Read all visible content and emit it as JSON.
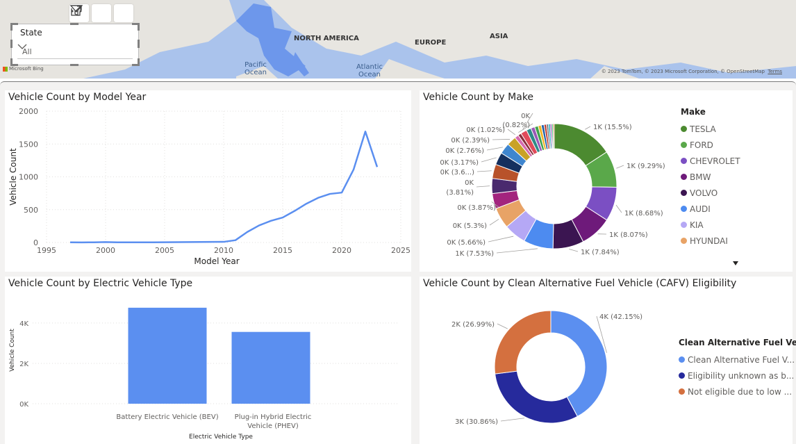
{
  "map": {
    "labels": [
      "NORTH AMERICA",
      "EUROPE",
      "ASIA"
    ],
    "oceans": [
      "Pacific Ocean",
      "Atlantic Ocean"
    ],
    "provider": "Microsoft Bing",
    "copyright": "© 2023 TomTom, © 2023 Microsoft Corporation, © OpenStreetMap",
    "terms": "Terms"
  },
  "visual_header": {
    "icons": [
      "filter-icon",
      "focus-mode-icon",
      "more-options-icon"
    ]
  },
  "slicer": {
    "title": "State",
    "value": "All"
  },
  "model_year_chart": {
    "title": "Vehicle Count by Model Year",
    "color": "#5b8ff0",
    "chart_data": {
      "type": "line",
      "xlabel": "Model Year",
      "ylabel": "Vehicle Count",
      "xlim": [
        1995,
        2025
      ],
      "ylim": [
        0,
        2000
      ],
      "x_ticks": [
        "1995",
        "2000",
        "2005",
        "2010",
        "2015",
        "2020",
        "2025"
      ],
      "y_ticks": [
        "0",
        "500",
        "1000",
        "1500",
        "2000"
      ],
      "x": [
        1997,
        1998,
        1999,
        2000,
        2001,
        2002,
        2003,
        2004,
        2005,
        2006,
        2007,
        2008,
        2009,
        2010,
        2011,
        2012,
        2013,
        2014,
        2015,
        2016,
        2017,
        2018,
        2019,
        2020,
        2021,
        2022,
        2023
      ],
      "y": [
        2,
        1,
        3,
        6,
        3,
        2,
        2,
        3,
        4,
        5,
        6,
        8,
        9,
        10,
        35,
        160,
        260,
        330,
        380,
        480,
        590,
        680,
        740,
        760,
        1110,
        1690,
        1150
      ]
    }
  },
  "make_chart": {
    "title": "Vehicle Count by Make",
    "legend_title": "Make",
    "legend": [
      {
        "name": "TESLA",
        "color": "#4c8a30"
      },
      {
        "name": "FORD",
        "color": "#5aa84a"
      },
      {
        "name": "CHEVROLET",
        "color": "#7b4fc3"
      },
      {
        "name": "BMW",
        "color": "#6e1a7a"
      },
      {
        "name": "VOLVO",
        "color": "#3b1551"
      },
      {
        "name": "AUDI",
        "color": "#4d8bf0"
      },
      {
        "name": "KIA",
        "color": "#b5a8f5"
      },
      {
        "name": "HYUNDAI",
        "color": "#e8a366"
      }
    ],
    "chart_data": {
      "type": "pie",
      "donut": true,
      "slices": [
        {
          "name": "TESLA",
          "value": 15.5,
          "label": "1K (15.5%)",
          "color": "#4c8a30"
        },
        {
          "name": "FORD",
          "value": 9.29,
          "label": "1K (9.29%)",
          "color": "#5aa84a"
        },
        {
          "name": "CHEVROLET",
          "value": 8.68,
          "label": "1K (8.68%)",
          "color": "#7b4fc3"
        },
        {
          "name": "BMW",
          "value": 8.07,
          "label": "1K (8.07%)",
          "color": "#6e1a7a"
        },
        {
          "name": "VOLVO",
          "value": 7.84,
          "label": "1K (7.84%)",
          "color": "#3b1551"
        },
        {
          "name": "AUDI",
          "value": 7.53,
          "label": "1K (7.53%)",
          "color": "#4d8bf0"
        },
        {
          "name": "KIA",
          "value": 5.66,
          "label": "0K (5.66%)",
          "color": "#b5a8f5"
        },
        {
          "name": "HYUNDAI",
          "value": 5.3,
          "label": "0K (5.3%)",
          "color": "#e8a366"
        },
        {
          "name": "",
          "value": 3.87,
          "label": "0K (3.87%)",
          "color": "#a3247e"
        },
        {
          "name": "",
          "value": 3.81,
          "label": "0K (3.81%)",
          "color": "#4a2a6e"
        },
        {
          "name": "",
          "value": 3.6,
          "label": "0K (3.6...)",
          "color": "#b8522a"
        },
        {
          "name": "",
          "value": 3.17,
          "label": "0K (3.17%)",
          "color": "#142f5e"
        },
        {
          "name": "",
          "value": 2.76,
          "label": "0K (2.76%)",
          "color": "#3f86cf"
        },
        {
          "name": "",
          "value": 2.39,
          "label": "0K (2.39%)",
          "color": "#c9a227"
        },
        {
          "name": "",
          "value": 1.02,
          "label": "0K (1.02%)",
          "color": "#d66bb0"
        },
        {
          "name": "",
          "value": 0.82,
          "label": "0K (0.82%)",
          "color": "#8a2f3c"
        },
        {
          "name": "",
          "value": 1.6,
          "label": "0K",
          "color": "#e14b5a"
        },
        {
          "name": "",
          "value": 1.2,
          "label": "",
          "color": "#2e8b87"
        },
        {
          "name": "",
          "value": 1.0,
          "label": "",
          "color": "#9b59b6"
        },
        {
          "name": "",
          "value": 0.9,
          "label": "",
          "color": "#3fa34d"
        },
        {
          "name": "",
          "value": 0.8,
          "label": "",
          "color": "#f0b429"
        },
        {
          "name": "",
          "value": 0.7,
          "label": "",
          "color": "#1f5fa8"
        },
        {
          "name": "",
          "value": 0.6,
          "label": "",
          "color": "#c0392b"
        },
        {
          "name": "",
          "value": 0.5,
          "label": "",
          "color": "#6c757d"
        },
        {
          "name": "",
          "value": 0.45,
          "label": "",
          "color": "#17a2b8"
        },
        {
          "name": "",
          "value": 0.4,
          "label": "",
          "color": "#8e44ad"
        },
        {
          "name": "",
          "value": 0.35,
          "label": "",
          "color": "#27ae60"
        },
        {
          "name": "",
          "value": 0.3,
          "label": "",
          "color": "#d35400"
        }
      ]
    }
  },
  "ev_type_chart": {
    "title": "Vehicle Count by Electric Vehicle Type",
    "color": "#5b8ff0",
    "chart_data": {
      "type": "bar",
      "categories": [
        "Battery Electric Vehicle (BEV)",
        "Plug-in Hybrid Electric Vehicle (PHEV)"
      ],
      "category_lines": [
        [
          "Battery Electric Vehicle (BEV)"
        ],
        [
          "Plug-in Hybrid Electric",
          "Vehicle (PHEV)"
        ]
      ],
      "values": [
        4760,
        3560
      ],
      "xlabel": "Electric Vehicle Type",
      "ylabel": "Vehicle Count",
      "ylim": [
        0,
        5100
      ],
      "y_ticks": [
        {
          "value": 0,
          "label": "0K"
        },
        {
          "value": 2000,
          "label": "2K"
        },
        {
          "value": 4000,
          "label": "4K"
        }
      ]
    }
  },
  "cafv_chart": {
    "title": "Vehicle Count by Clean Alternative Fuel Vehicle (CAFV) Eligibility",
    "legend_title": "Clean Alternative Fuel Ve...",
    "legend": [
      {
        "name": "Clean Alternative Fuel V...",
        "color": "#5b8ff0"
      },
      {
        "name": "Eligibility unknown as b...",
        "color": "#262a9c"
      },
      {
        "name": "Not eligible due to low ...",
        "color": "#d4703f"
      }
    ],
    "chart_data": {
      "type": "pie",
      "donut": true,
      "slices": [
        {
          "name": "Clean Alternative Fuel V...",
          "value": 42.15,
          "label": "4K (42.15%)",
          "color": "#5b8ff0"
        },
        {
          "name": "Eligibility unknown as b...",
          "value": 30.86,
          "label": "3K (30.86%)",
          "color": "#262a9c"
        },
        {
          "name": "Not eligible due to low ...",
          "value": 26.99,
          "label": "2K (26.99%)",
          "color": "#d4703f"
        }
      ]
    }
  }
}
